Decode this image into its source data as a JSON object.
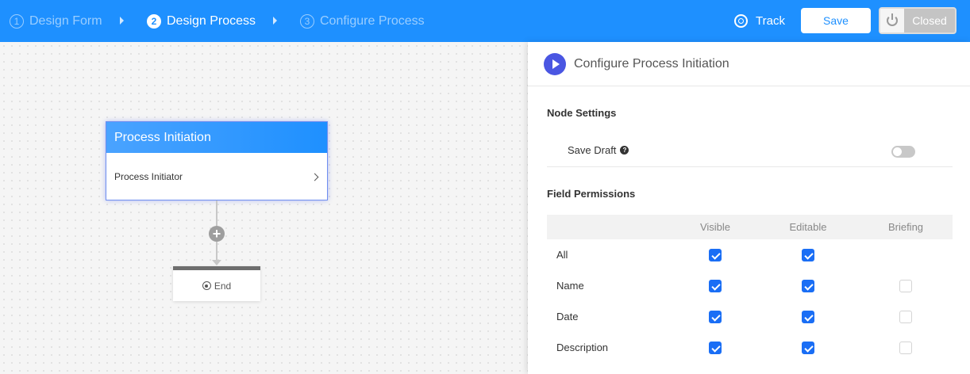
{
  "header": {
    "steps": [
      {
        "num": "1",
        "label": "Design Form"
      },
      {
        "num": "2",
        "label": "Design Process"
      },
      {
        "num": "3",
        "label": "Configure Process"
      }
    ],
    "track_label": "Track",
    "save_label": "Save",
    "closed_label": "Closed"
  },
  "canvas": {
    "node_title": "Process Initiation",
    "node_row": "Process Initiator",
    "end_label": "End"
  },
  "panel": {
    "title": "Configure Process Initiation",
    "node_settings_title": "Node Settings",
    "save_draft_label": "Save Draft",
    "help_glyph": "?",
    "save_draft_on": false,
    "field_permissions_title": "Field Permissions",
    "columns": [
      "Visible",
      "Editable",
      "Briefing"
    ],
    "rows": [
      {
        "label": "All",
        "visible": true,
        "editable": true,
        "briefing": null
      },
      {
        "label": "Name",
        "visible": true,
        "editable": true,
        "briefing": false
      },
      {
        "label": "Date",
        "visible": true,
        "editable": true,
        "briefing": false
      },
      {
        "label": "Description",
        "visible": true,
        "editable": true,
        "briefing": false
      }
    ]
  },
  "colors": {
    "topbar": "#1e90ff",
    "checkbox_on": "#1a6ef5",
    "play_icon": "#4a56e2"
  }
}
